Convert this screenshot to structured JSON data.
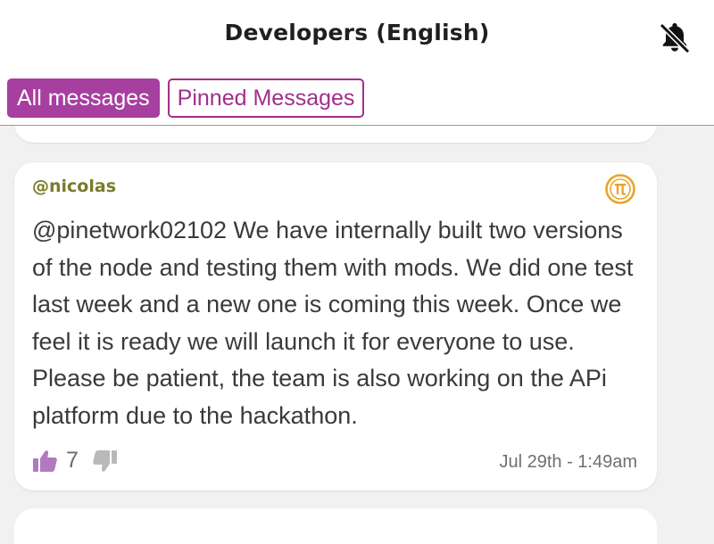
{
  "header": {
    "title": "Developers (English)",
    "notification_icon": "bell-off-icon"
  },
  "tabs": [
    {
      "label": "All messages",
      "active": true
    },
    {
      "label": "Pinned Messages",
      "active": false
    }
  ],
  "message": {
    "author": "@nicolas",
    "badge_icon": "pi-coin-icon",
    "text": "@pinetwork02102 We have internally built two versions of the node and testing them with mods. We did one test last week and a new one is coming this week. Once we feel it is ready we will launch it for everyone to use. Please be patient, the team is also working on the APi platform due to the hackathon.",
    "likes": "7",
    "timestamp": "Jul 29th - 1:49am"
  },
  "colors": {
    "accent": "#a73fa0",
    "author": "#7a7a2a",
    "badge": "#e8a52a",
    "like": "#b07ac0",
    "dislike": "#b9b9b9",
    "background": "#f1f1f1"
  }
}
